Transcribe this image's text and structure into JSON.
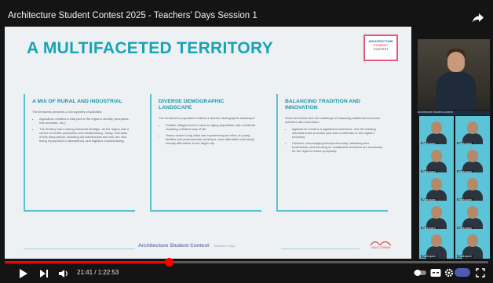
{
  "video": {
    "title": "Architecture Student Contest 2025 - Teachers' Days Session 1",
    "time": "21:41 / 1:22:53",
    "progress": 0.34
  },
  "slide": {
    "title": "A MULTIFACETED TERRITORY",
    "badge_line1": "ARCHITECTURE",
    "badge_line2": "STUDENT",
    "badge_line3": "CONTEST",
    "columns": [
      {
        "heading": "A MIX OF RURAL AND INDUSTRIAL",
        "intro": "The territories presents a rich tapestry of activities:",
        "bullets": [
          "Agriculture remains a vital part of the region's identity (vineyards, fruit orchards, etc.).",
          "The territory has a strong industrial heritage, as the region was a center for textile production and metalworking. Today, remnants of this early period, including old warehouses and mill, are now being repurposed or abandoned, and logistics manufacturing."
        ]
      },
      {
        "heading": "DIVERSE DEMOGRAPHIC LANDSCAPE",
        "intro": "The territories's population reflects a diverse demographic landscape:",
        "bullets": [
          "Smaller villages tend to have an aging population, with residents requiring a distinct way of life.",
          "Towns closer to big cities are experiencing an influx of young families and professionals seeking a more affordable and family-friendly alternative to the larger city."
        ]
      },
      {
        "heading": "BALANCING TRADITION AND INNOVATION",
        "intro": "Some territories face the challenge of balancing traditional economic activities with innovation:",
        "bullets": [
          "Agriculture remains a significant contributor, and the existing industrial base provides jobs and contributes to the region's economy.",
          "However, encouraging entrepreneurship, attracting new businesses, and focusing on sustainable practices are necessary for the region's future prosperity."
        ]
      }
    ],
    "footer": "Architecture Student Contest",
    "footer_sub": "Teachers' Days",
    "footer_logo": "SAINT-GOBAIN"
  },
  "meeting": {
    "gallery_label": "Architecture Student Contest",
    "participants": [
      "Participant",
      "Participant",
      "Participant",
      "Participant",
      "Participant",
      "Participant",
      "Participant",
      "Participant",
      "Participant",
      "Participant"
    ]
  },
  "colors": {
    "accent": "#16a4b6",
    "progress": "#ff0000",
    "tile": "#5cc4d8"
  }
}
